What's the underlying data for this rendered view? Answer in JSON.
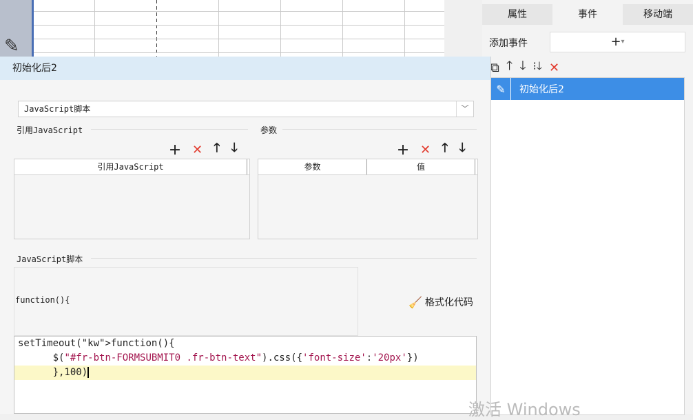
{
  "right_panel": {
    "tabs": [
      {
        "label": "属性"
      },
      {
        "label": "事件"
      },
      {
        "label": "移动端"
      }
    ],
    "add_event_label": "添加事件",
    "add_event_button": "+",
    "events": [
      {
        "label": "初始化后2"
      }
    ]
  },
  "dialog": {
    "title": "初始化后2",
    "type_select": "JavaScript脚本",
    "ref_js_section": "引用JavaScript",
    "ref_js_header": "引用JavaScript",
    "params_section": "参数",
    "params_headers": [
      "参数",
      "值"
    ],
    "script_section": "JavaScript脚本",
    "function_open": "function(){",
    "format_button": "格式化代码",
    "code_lines": [
      "setTimeout(function(){",
      "      $(\"#fr-btn-FORMSUBMIT0 .fr-btn-text\").css({'font-size':'20px'})",
      "      },100)"
    ]
  },
  "watermark": "激活 Windows",
  "colors": {
    "accent": "#3d8ee6",
    "delete": "#e23b2e",
    "title_bar": "#dcebf7",
    "highlight_line": "#fcf8c8"
  }
}
